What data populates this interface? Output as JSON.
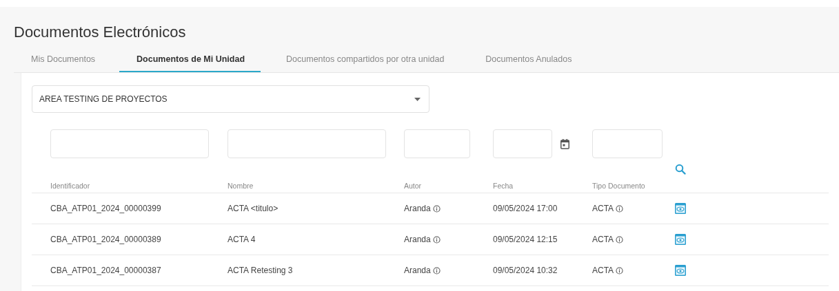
{
  "title": "Documentos Electrónicos",
  "tabs": [
    {
      "label": "Mis Documentos",
      "selected": false
    },
    {
      "label": "Documentos de Mi Unidad",
      "selected": true
    },
    {
      "label": "Documentos compartidos por otra unidad",
      "selected": false
    },
    {
      "label": "Documentos Anulados",
      "selected": false
    }
  ],
  "unit_select": {
    "value": "AREA TESTING DE PROYECTOS"
  },
  "table": {
    "columns": [
      "Identificador",
      "Nombre",
      "Autor",
      "Fecha",
      "Tipo Documento"
    ],
    "rows": [
      {
        "identificador": "CBA_ATP01_2024_00000399",
        "nombre": "ACTA <titulo>",
        "autor": "Aranda",
        "fecha": "09/05/2024 17:00",
        "tipo": "ACTA"
      },
      {
        "identificador": "CBA_ATP01_2024_00000389",
        "nombre": "ACTA 4",
        "autor": "Aranda",
        "fecha": "09/05/2024 12:15",
        "tipo": "ACTA"
      },
      {
        "identificador": "CBA_ATP01_2024_00000387",
        "nombre": "ACTA Retesting 3",
        "autor": "Aranda",
        "fecha": "09/05/2024 10:32",
        "tipo": "ACTA"
      }
    ]
  }
}
